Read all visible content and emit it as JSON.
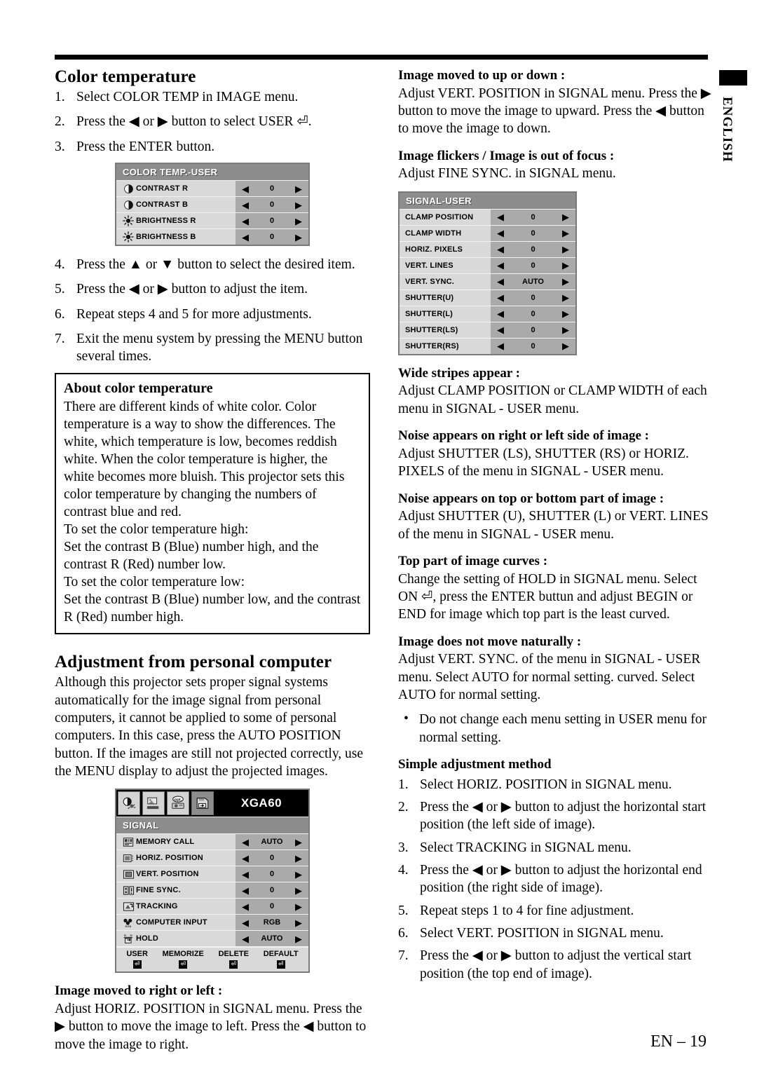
{
  "page": {
    "language_tab": "ENGLISH",
    "footer": "EN – 19"
  },
  "left_column": {
    "section1_title": "Color temperature",
    "steps_top": [
      {
        "num": "1.",
        "text": "Select COLOR TEMP in IMAGE menu."
      },
      {
        "num": "2.",
        "text": "Press the ◀ or ▶ button to select USER ⏎."
      },
      {
        "num": "3.",
        "text": "Press the ENTER button."
      }
    ],
    "steps_bottom": [
      {
        "num": "4.",
        "text": "Press the ▲ or ▼ button to select the desired item."
      },
      {
        "num": "5.",
        "text": "Press the ◀ or ▶ button to adjust the item."
      },
      {
        "num": "6.",
        "text": "Repeat steps 4 and 5 for more adjustments."
      },
      {
        "num": "7.",
        "text": "Exit the menu system by pressing the MENU button several times."
      }
    ],
    "about_box": {
      "heading": "About color temperature",
      "paragraph": "There are different kinds of white color. Color temperature is a way to show the differences. The white, which temperature is low, becomes reddish white. When the color temperature is higher, the white becomes more bluish. This projector sets this color temperature by changing the numbers of contrast blue and red.",
      "line_high_title": "To set the color temperature high:",
      "line_high_body": "Set the contrast B (Blue) number high, and the contrast R (Red) number low.",
      "line_low_title": "To set the color temperature low:",
      "line_low_body": "Set the contrast B (Blue) number low, and the contrast R (Red) number high."
    },
    "section2_title": "Adjustment from personal computer",
    "section2_body": "Although this projector sets proper signal systems automatically for the image signal from personal computers, it cannot be applied to some of personal computers.  In this case, press the AUTO POSITION button.  If the images are still not projected correctly, use the MENU display to adjust the projected images.",
    "image_moved_lr": {
      "heading": "Image moved to right or left :",
      "body": "Adjust HORIZ. POSITION in SIGNAL menu.  Press the ▶ button to move the image to left.  Press the ◀ button to move the image to right."
    }
  },
  "right_column": {
    "image_moved_ud": {
      "heading": "Image moved to up or down :",
      "body": "Adjust VERT. POSITION in SIGNAL menu.  Press the ▶ button to move the image to upward.  Press the ◀ button to move the image to down."
    },
    "image_flickers": {
      "heading": "Image flickers / Image is out of focus :",
      "body": "Adjust FINE SYNC. in SIGNAL menu."
    },
    "wide_stripes": {
      "heading": "Wide stripes appear :",
      "body": "Adjust CLAMP POSITION or CLAMP WIDTH of each menu in SIGNAL - USER menu."
    },
    "noise_sides": {
      "heading": "Noise appears on right or left side of image :",
      "body": "Adjust SHUTTER (LS), SHUTTER (RS) or  HORIZ. PIXELS  of the menu in SIGNAL - USER menu."
    },
    "noise_topbottom": {
      "heading": "Noise appears on top or bottom part of image :",
      "body": "Adjust SHUTTER (U), SHUTTER (L) or VERT. LINES of the menu in SIGNAL - USER menu."
    },
    "top_curves": {
      "heading": "Top part of image curves :",
      "body": "Change the setting of HOLD in SIGNAL menu. Select ON ⏎, press the ENTER buttun and adjust BEGIN or END for image which top part is the least curved."
    },
    "not_natural": {
      "heading": "Image does not move naturally :",
      "body": "Adjust VERT. SYNC. of the menu in SIGNAL - USER menu.  Select AUTO for normal setting. curved.  Select AUTO for normal setting."
    },
    "bullet_note": "Do not change each menu setting in USER menu for normal setting.",
    "simple_method_title": "Simple adjustment method",
    "simple_steps": [
      {
        "num": "1.",
        "text": "Select HORIZ. POSITION in SIGNAL menu."
      },
      {
        "num": "2.",
        "text": "Press the ◀ or ▶ button to adjust the horizontal start position (the left side of image)."
      },
      {
        "num": "3.",
        "text": "Select TRACKING in SIGNAL menu."
      },
      {
        "num": "4.",
        "text": "Press the ◀ or ▶ button to adjust the horizontal end position (the right side of image)."
      },
      {
        "num": "5.",
        "text": "Repeat steps 1 to 4 for fine adjustment."
      },
      {
        "num": "6.",
        "text": "Select VERT. POSITION in SIGNAL menu."
      },
      {
        "num": "7.",
        "text": "Press the ◀ or ▶ button to adjust the vertical start position (the top end of image)."
      }
    ]
  },
  "osd_color_temp": {
    "title": "COLOR TEMP.-USER",
    "rows": [
      {
        "icon": "contrast-icon",
        "label": "CONTRAST R",
        "value": "0",
        "left": "◀",
        "right": "▶"
      },
      {
        "icon": "contrast-icon",
        "label": "CONTRAST B",
        "value": "0",
        "left": "◀",
        "right": "▶"
      },
      {
        "icon": "brightness-icon",
        "label": "BRIGHTNESS R",
        "value": "0",
        "left": "◀",
        "right": "▶"
      },
      {
        "icon": "brightness-icon",
        "label": "BRIGHTNESS B",
        "value": "0",
        "left": "◀",
        "right": "▶"
      }
    ]
  },
  "osd_signal_user": {
    "title": "SIGNAL-USER",
    "rows": [
      {
        "label": "CLAMP POSITION",
        "value": "0",
        "left": "◀",
        "right": "▶"
      },
      {
        "label": "CLAMP WIDTH",
        "value": "0",
        "left": "◀",
        "right": "▶"
      },
      {
        "label": "HORIZ. PIXELS",
        "value": "0",
        "left": "◀",
        "right": "▶"
      },
      {
        "label": "VERT. LINES",
        "value": "0",
        "left": "◀",
        "right": "▶"
      },
      {
        "label": "VERT. SYNC.",
        "value": "AUTO",
        "left": "◀",
        "right": "▶"
      },
      {
        "label": "SHUTTER(U)",
        "value": "0",
        "left": "◀",
        "right": "▶"
      },
      {
        "label": "SHUTTER(L)",
        "value": "0",
        "left": "◀",
        "right": "▶"
      },
      {
        "label": "SHUTTER(LS)",
        "value": "0",
        "left": "◀",
        "right": "▶"
      },
      {
        "label": "SHUTTER(RS)",
        "value": "0",
        "left": "◀",
        "right": "▶"
      }
    ]
  },
  "osd_signal": {
    "mode_label": "XGA60",
    "tabs": [
      "image-tab-icon",
      "screen-tab-icon",
      "option-tab-icon",
      "signal-tab-icon"
    ],
    "selected_tab": 3,
    "title": "SIGNAL",
    "rows": [
      {
        "icon": "memory-call-icon",
        "label": "MEMORY CALL",
        "value": "AUTO",
        "left": "◀",
        "right": "▶"
      },
      {
        "icon": "horiz-position-icon",
        "label": "HORIZ. POSITION",
        "value": "0",
        "left": "◀",
        "right": "▶"
      },
      {
        "icon": "vert-position-icon",
        "label": "VERT. POSITION",
        "value": "0",
        "left": "◀",
        "right": "▶"
      },
      {
        "icon": "fine-sync-icon",
        "label": "FINE SYNC.",
        "value": "0",
        "left": "◀",
        "right": "▶"
      },
      {
        "icon": "tracking-icon",
        "label": "TRACKING",
        "value": "0",
        "left": "◀",
        "right": "▶"
      },
      {
        "icon": "computer-input-icon",
        "label": "COMPUTER INPUT",
        "value": "RGB",
        "left": "◀",
        "right": "▶"
      },
      {
        "icon": "hold-icon",
        "label": "HOLD",
        "value": "AUTO",
        "left": "◀",
        "right": "▶"
      }
    ],
    "footer_buttons": [
      {
        "label": "USER",
        "glyph": "⏎"
      },
      {
        "label": "MEMORIZE",
        "glyph": "⏎"
      },
      {
        "label": "DELETE",
        "glyph": "⏎"
      },
      {
        "label": "DEFAULT",
        "glyph": "⏎"
      }
    ]
  }
}
